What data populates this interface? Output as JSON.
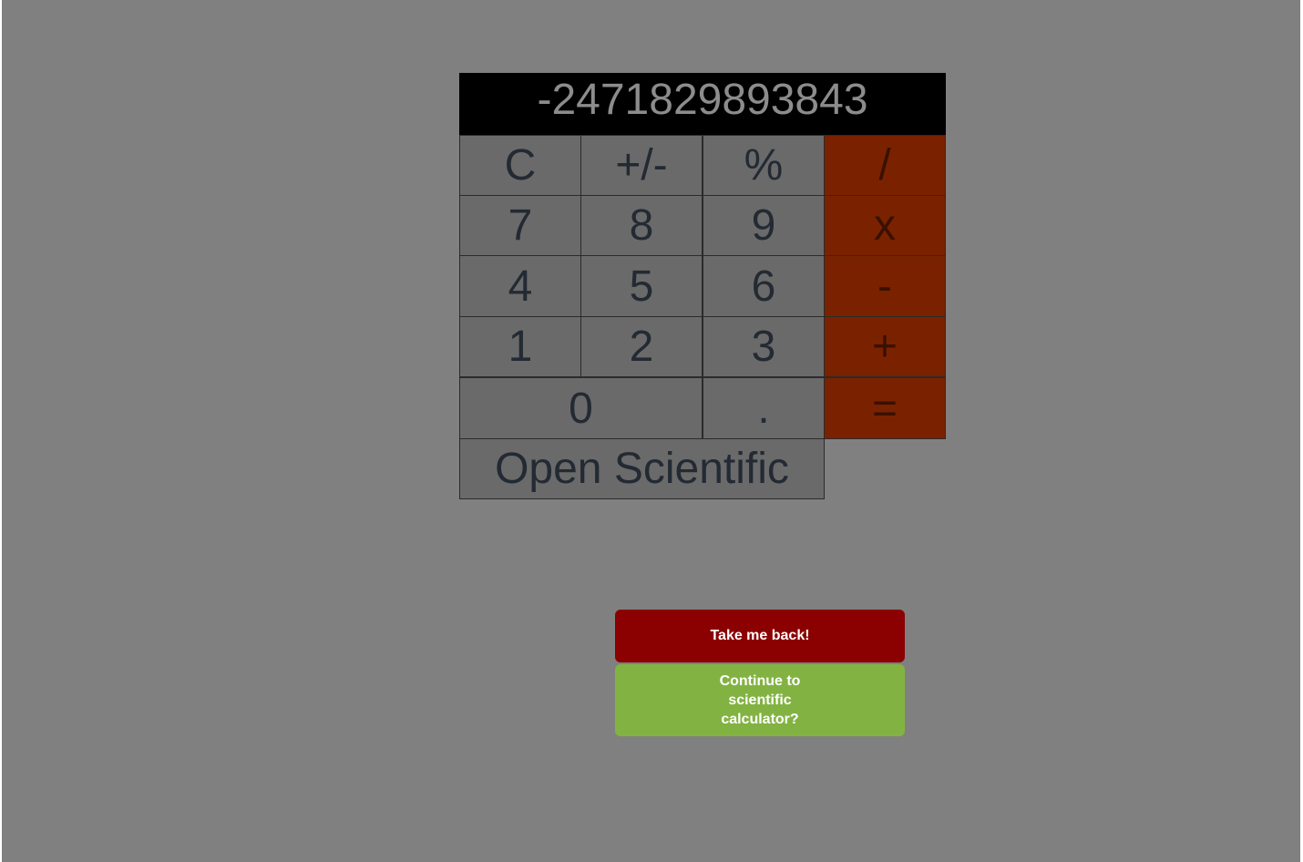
{
  "display": {
    "value": "-2471829893843"
  },
  "keys": {
    "clear": "C",
    "sign": "+/-",
    "percent": "%",
    "divide": "/",
    "seven": "7",
    "eight": "8",
    "nine": "9",
    "multiply": "x",
    "four": "4",
    "five": "5",
    "six": "6",
    "subtract": "-",
    "one": "1",
    "two": "2",
    "three": "3",
    "add": "+",
    "zero": "0",
    "decimal": ".",
    "equals": "="
  },
  "scientific_toggle": "Open Scientific",
  "dialog": {
    "back_label": "Take me back!",
    "continue_label": "Continue to scientific calculator?"
  },
  "colors": {
    "overlay": "#808080",
    "operator": "#7a2200",
    "back_button": "#8b0000",
    "continue_button": "#82b342"
  }
}
